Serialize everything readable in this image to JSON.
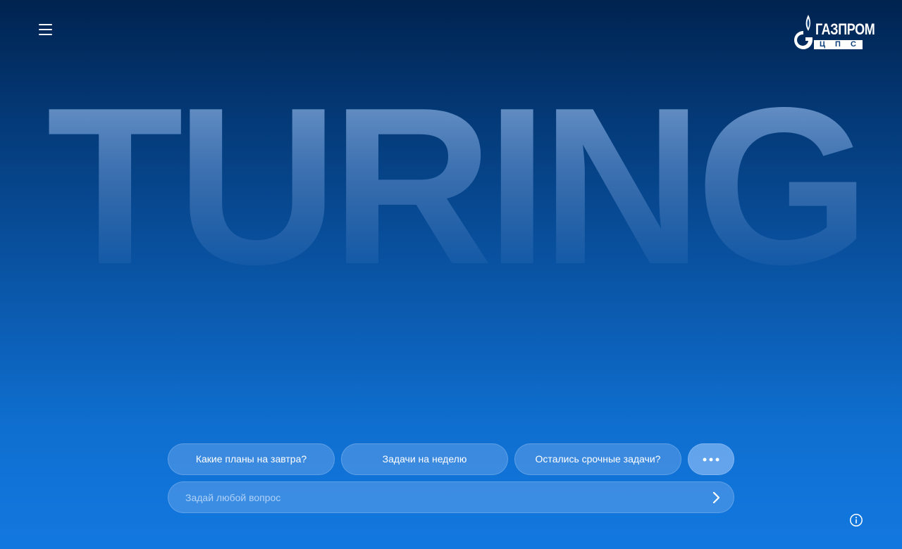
{
  "header": {
    "menu_icon": "hamburger-menu-icon",
    "logo": {
      "name": "ГАЗПРОМ",
      "sub": "ЦПС",
      "icon": "flame-logo-icon"
    }
  },
  "hero": {
    "title": "TURING"
  },
  "suggestions": [
    {
      "label": "Какие планы на завтра?"
    },
    {
      "label": "Задачи на неделю"
    },
    {
      "label": "Остались срочные задачи?"
    }
  ],
  "more_icon": "more-dots-icon",
  "query": {
    "placeholder": "Задай любой вопрос",
    "value": "",
    "send_icon": "chevron-right-icon"
  },
  "footer": {
    "info_icon": "info-icon"
  },
  "colors": {
    "background_top": "#002350",
    "background_bottom": "#1278e0",
    "chip": "#78aff0",
    "text": "#ffffff"
  }
}
